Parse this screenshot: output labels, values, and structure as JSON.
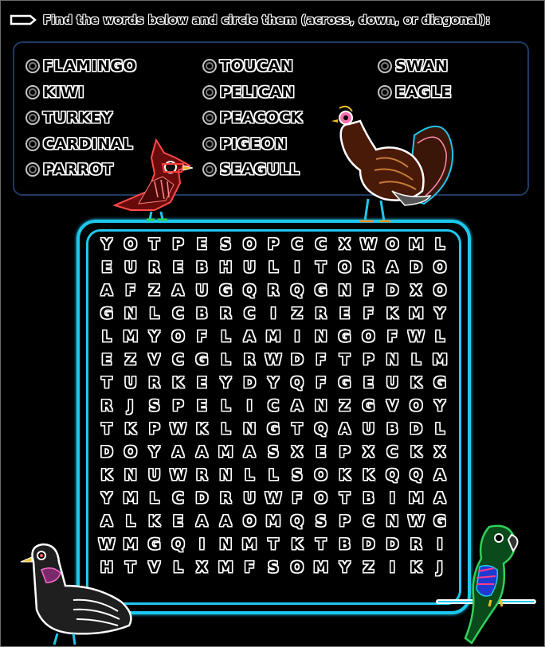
{
  "instructions": "Find the words below and circle them (across, down, or diagonal):",
  "word_bank": {
    "columns": [
      [
        "FLAMINGO",
        "KIWI",
        "TURKEY",
        "CARDINAL",
        "PARROT"
      ],
      [
        "TOUCAN",
        "PELICAN",
        "PEACOCK",
        "PIGEON",
        "SEAGULL"
      ],
      [
        "SWAN",
        "EAGLE"
      ]
    ]
  },
  "grid": {
    "rows": [
      "YOTPESOPCCXWOML",
      "EUREBHULITORADO",
      "AFZAUGQRQGNFDXO",
      "GNLCBRCIZREFKMY",
      "LMYOFLAMINGOFWL",
      "EZVCGLRWDFTPNLM",
      "TURKEYDYQFGEUKG",
      "RJSPELICANZGVOY",
      "TKPWKLNGTQAUBDL",
      "DOYAAMASXEPXCKX",
      "KNUWRNLLSOKKQQA",
      "YMLCDRUWFOTBIMA",
      "ALKEAAOMQSPCNWG",
      "WMGQINMTKTBDDRI",
      "HTVLXMFSOMYZIKJ"
    ]
  },
  "illustrations": [
    "cardinal-icon",
    "turkey-icon",
    "pigeon-icon",
    "parrot-icon"
  ],
  "colors": {
    "grid_border": "#1ec8f0",
    "wordbank_border": "#1e3b63",
    "background": "#000000"
  }
}
